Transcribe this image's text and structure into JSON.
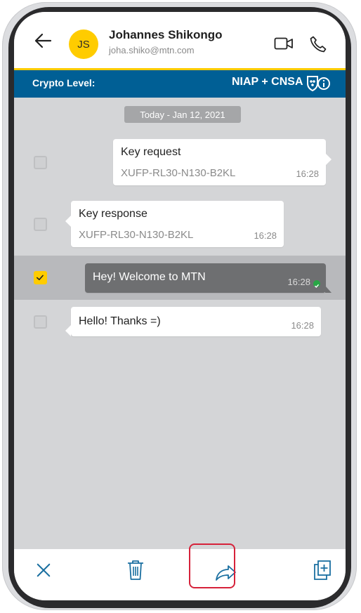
{
  "header": {
    "avatar_initials": "JS",
    "contact_name": "Johannes Shikongo",
    "contact_email": "joha.shiko@mtn.com"
  },
  "crypto": {
    "label": "Crypto Level:",
    "value": "NIAP + CNSA"
  },
  "date_separator": "Today - Jan 12, 2021",
  "messages": [
    {
      "title": "Key request",
      "subtitle": "XUFP-RL30-N130-B2KL",
      "time": "16:28",
      "direction": "outgoing",
      "selected": false
    },
    {
      "title": "Key response",
      "subtitle": "XUFP-RL30-N130-B2KL",
      "time": "16:28",
      "direction": "incoming",
      "selected": false
    },
    {
      "title": "Hey! Welcome to MTN",
      "time": "16:28",
      "direction": "outgoing",
      "selected": true,
      "status": "delivered"
    },
    {
      "title": "Hello! Thanks =)",
      "time": "16:28",
      "direction": "incoming",
      "selected": false
    }
  ],
  "bottom_bar": {
    "actions": [
      "close",
      "delete",
      "forward",
      "copy"
    ],
    "highlighted": "forward"
  },
  "colors": {
    "accent": "#ffcc00",
    "crypto_bar": "#005f95",
    "icon": "#1a6fa0",
    "highlight_border": "#d6223a"
  }
}
